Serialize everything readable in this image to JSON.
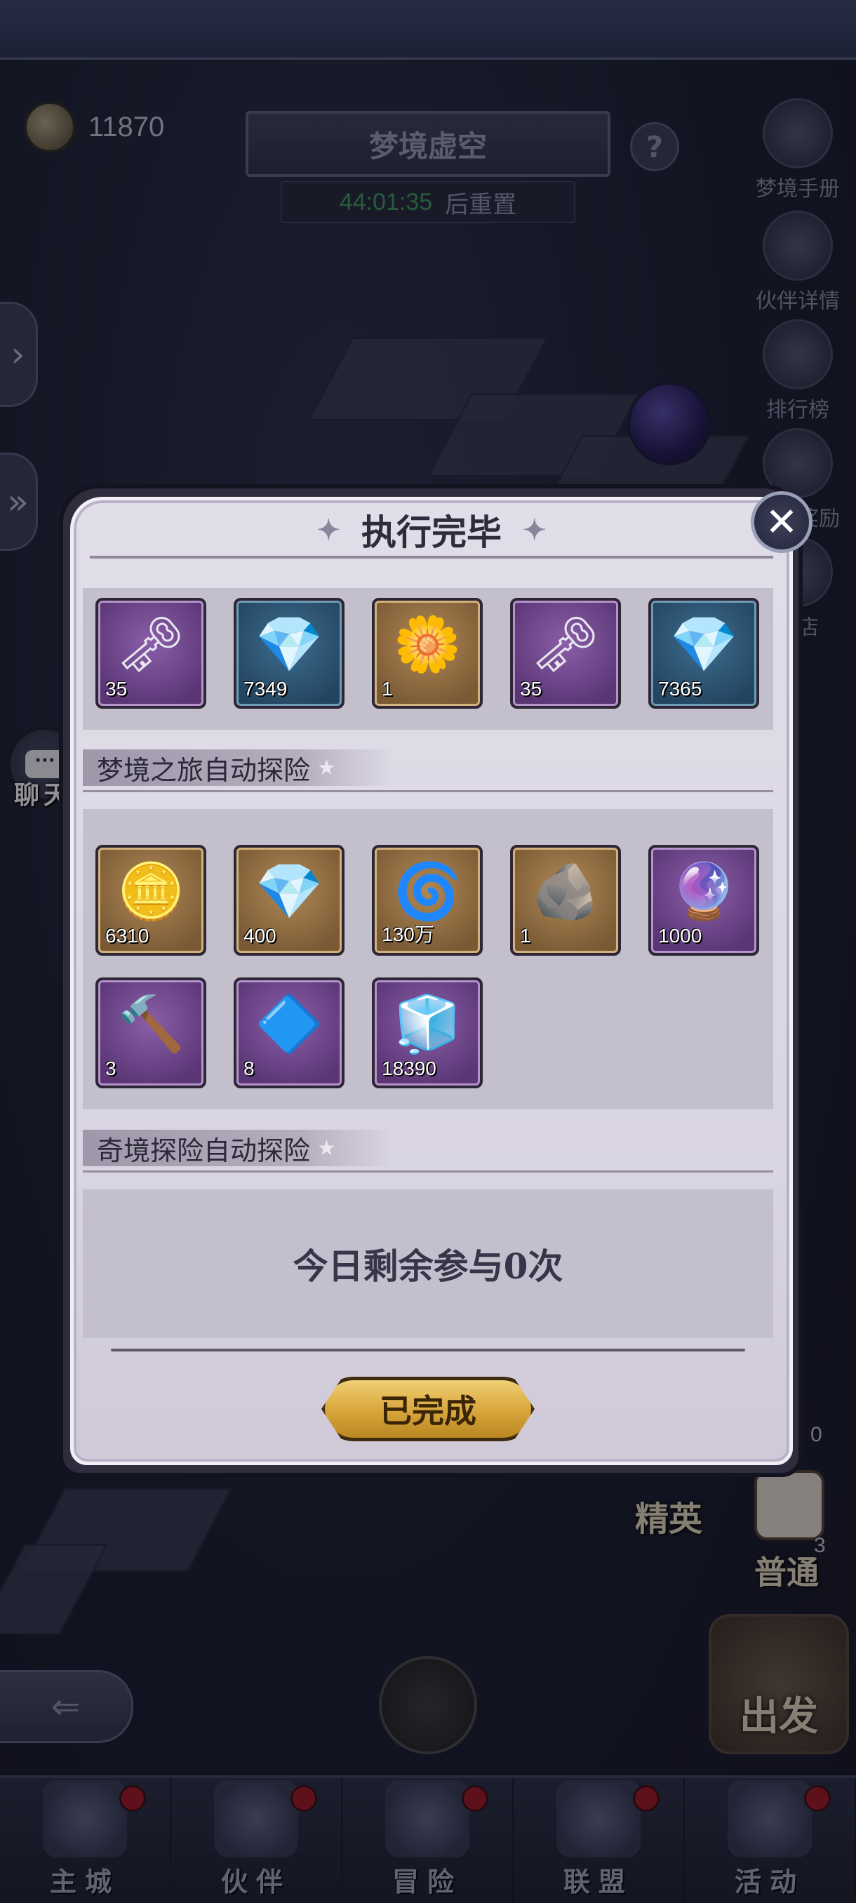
{
  "header": {
    "currency_value": "11870",
    "map_title": "梦境虚空",
    "reset_time": "44:01:35",
    "reset_suffix": "后重置",
    "help_label": "?"
  },
  "side_menu": [
    {
      "label": "梦境手册",
      "icon": "book-icon"
    },
    {
      "label": "伙伴详情",
      "icon": "wolf-icon"
    },
    {
      "label": "排行榜",
      "icon": "trophy-icon"
    },
    {
      "label": "最终奖励",
      "icon": "gift-icon"
    },
    {
      "label": "商店",
      "icon": "shop-icon"
    }
  ],
  "chat": {
    "bubble": "···",
    "label": "聊天"
  },
  "modes": {
    "elite_label": "精英",
    "normal_label": "普通",
    "depart_label": "出发",
    "elite_count": "0",
    "normal_count": "3"
  },
  "bottom_nav": [
    {
      "label": "主城",
      "icon": "castle-icon"
    },
    {
      "label": "伙伴",
      "icon": "witch-hat-icon"
    },
    {
      "label": "冒险",
      "icon": "compass-icon"
    },
    {
      "label": "联盟",
      "icon": "shield-icon"
    },
    {
      "label": "活动",
      "icon": "cards-icon"
    }
  ],
  "dialog": {
    "title": "执行完毕",
    "close_label": "✕",
    "top_rewards": [
      {
        "icon": "gold-key-icon",
        "qty": "35",
        "rarity": "purple"
      },
      {
        "icon": "blue-crystal-icon",
        "qty": "7349",
        "rarity": "blue"
      },
      {
        "icon": "golden-rose-icon",
        "qty": "1",
        "rarity": "brown"
      },
      {
        "icon": "gold-key-icon",
        "qty": "35",
        "rarity": "purple"
      },
      {
        "icon": "blue-crystal-icon",
        "qty": "7365",
        "rarity": "blue"
      }
    ],
    "section1_title": "梦境之旅自动探险",
    "section1_rewards": [
      {
        "icon": "gold-coin-icon",
        "qty": "6310",
        "rarity": "brown"
      },
      {
        "icon": "diamond-icon",
        "qty": "400",
        "rarity": "brown"
      },
      {
        "icon": "spiral-coin-icon",
        "qty": "130万",
        "rarity": "brown"
      },
      {
        "icon": "stone-icon",
        "qty": "1",
        "rarity": "brown"
      },
      {
        "icon": "swirl-orb-icon",
        "qty": "1000",
        "rarity": "purple"
      },
      {
        "icon": "hammer-coin-icon",
        "qty": "3",
        "rarity": "purple"
      },
      {
        "icon": "blue-gem-icon",
        "qty": "8",
        "rarity": "purple"
      },
      {
        "icon": "ice-crystal-icon",
        "qty": "18390",
        "rarity": "purple"
      }
    ],
    "section2_title": "奇境探险自动探险",
    "remaining_text": "今日剩余参与0次",
    "complete_label": "已完成"
  },
  "colors": {
    "dialog_bg": "#dcd7e4",
    "panel_bg": "#c4bfcc",
    "button_gold": "#d7a53a",
    "timer_green": "#3f9e5c",
    "notification_red": "#a31622"
  }
}
